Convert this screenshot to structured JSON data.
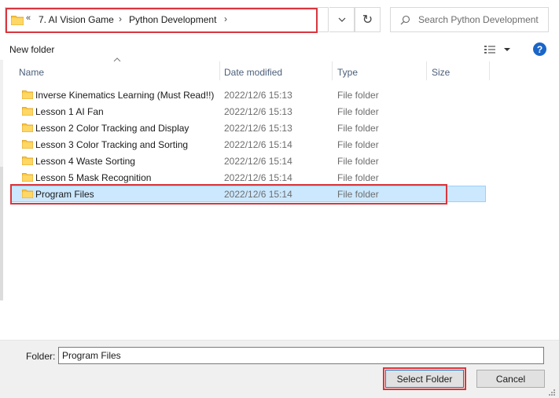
{
  "address_bar": {
    "overflow_glyph": "«",
    "breadcrumbs": [
      "7. AI Vision Game",
      "Python Development"
    ],
    "separator": "›"
  },
  "search": {
    "placeholder": "Search Python Development"
  },
  "toolbar": {
    "new_folder_label": "New folder",
    "help_glyph": "?"
  },
  "columns": {
    "name": "Name",
    "date_modified": "Date modified",
    "type": "Type",
    "size": "Size"
  },
  "files": [
    {
      "name": "Inverse Kinematics Learning (Must Read!!)",
      "date": "2022/12/6 15:13",
      "type": "File folder",
      "selected": false
    },
    {
      "name": "Lesson 1 AI Fan",
      "date": "2022/12/6 15:13",
      "type": "File folder",
      "selected": false
    },
    {
      "name": "Lesson 2 Color Tracking and Display",
      "date": "2022/12/6 15:13",
      "type": "File folder",
      "selected": false
    },
    {
      "name": "Lesson 3 Color Tracking and Sorting",
      "date": "2022/12/6 15:14",
      "type": "File folder",
      "selected": false
    },
    {
      "name": "Lesson 4 Waste Sorting",
      "date": "2022/12/6 15:14",
      "type": "File folder",
      "selected": false
    },
    {
      "name": "Lesson 5 Mask Recognition",
      "date": "2022/12/6 15:14",
      "type": "File folder",
      "selected": false
    },
    {
      "name": "Program Files",
      "date": "2022/12/6 15:14",
      "type": "File folder",
      "selected": true
    }
  ],
  "footer": {
    "folder_label": "Folder:",
    "folder_value": "Program Files",
    "select_label": "Select Folder",
    "cancel_label": "Cancel"
  },
  "icons": {
    "folder": "folder-icon",
    "search": "search-icon",
    "refresh": "refresh-icon",
    "dropdown": "chevron-down-icon",
    "view": "view-options-icon",
    "help": "help-icon"
  },
  "colors": {
    "highlight": "#d9363e",
    "selection": "#cce8ff",
    "folder": "#ffc83d",
    "help": "#1a66c8"
  }
}
